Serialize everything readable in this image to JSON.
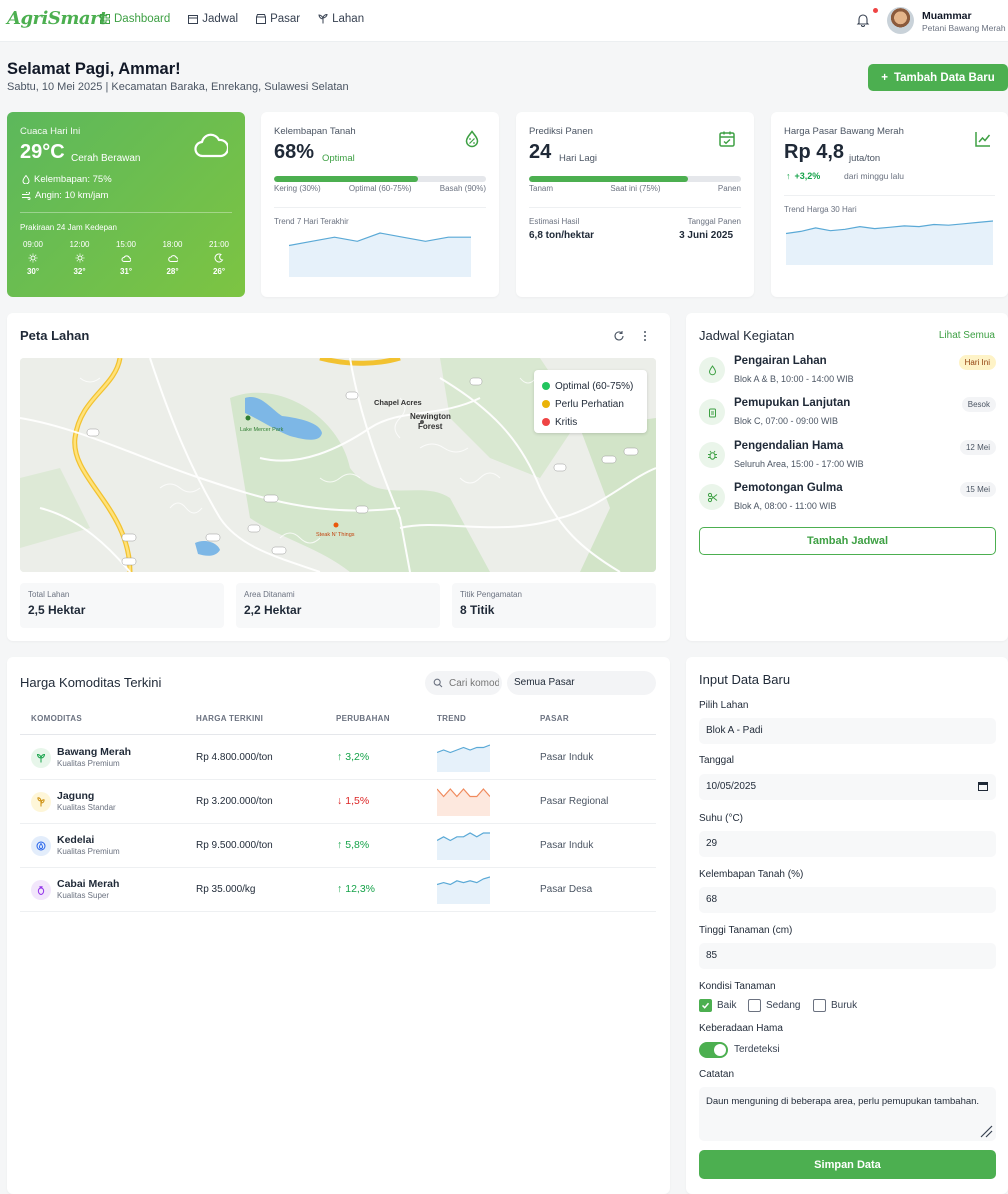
{
  "nav": {
    "logo": "AgriSmart",
    "links": [
      "Dashboard",
      "Jadwal",
      "Pasar",
      "Lahan"
    ],
    "user_name": "Muammar",
    "user_role": "Petani Bawang Merah"
  },
  "header": {
    "greeting": "Selamat Pagi, Ammar!",
    "subtitle": "Sabtu, 10 Mei 2025 | Kecamatan Baraka, Enrekang, Sulawesi Selatan",
    "add_button": "Tambah Data Baru"
  },
  "weather": {
    "label": "Cuaca Hari Ini",
    "temp": "29°C",
    "desc": "Cerah Berawan",
    "humidity": "Kelembapan: 75%",
    "wind": "Angin: 10 km/jam",
    "forecast_label": "Prakiraan 24 Jam Kedepan",
    "hours": [
      {
        "time": "09:00",
        "temp": "30°",
        "icon": "sun-icon"
      },
      {
        "time": "12:00",
        "temp": "32°",
        "icon": "sun-icon"
      },
      {
        "time": "15:00",
        "temp": "31°",
        "icon": "cloud-sun-icon"
      },
      {
        "time": "18:00",
        "temp": "28°",
        "icon": "cloud-icon"
      },
      {
        "time": "21:00",
        "temp": "26°",
        "icon": "moon-icon"
      }
    ]
  },
  "soil": {
    "title": "Kelembapan Tanah",
    "value": "68%",
    "status": "Optimal",
    "progress": 0.68,
    "labels": [
      "Kering (30%)",
      "Optimal (60-75%)",
      "Basah (90%)"
    ],
    "trend_label": "Trend 7 Hari Terakhir",
    "trend": [
      66,
      67,
      68,
      67,
      69,
      68,
      67,
      68,
      68
    ]
  },
  "harvest": {
    "title": "Prediksi Panen",
    "value": "24",
    "unit": "Hari Lagi",
    "progress": 0.75,
    "labels": [
      "Tanam",
      "Saat ini (75%)",
      "Panen"
    ],
    "est_label": "Estimasi Hasil",
    "est_value": "6,8 ton/hektar",
    "date_label": "Tanggal Panen",
    "date_value": "3 Juni 2025"
  },
  "market": {
    "title": "Harga Pasar Bawang Merah",
    "value": "Rp 4,8",
    "unit": "juta/ton",
    "change": "+3,2%",
    "change_note": "dari minggu lalu",
    "trend_label": "Trend Harga 30 Hari",
    "trend": [
      4.62,
      4.65,
      4.7,
      4.66,
      4.68,
      4.72,
      4.69,
      4.71,
      4.73,
      4.72,
      4.75,
      4.74,
      4.76,
      4.78,
      4.8
    ]
  },
  "map": {
    "title": "Peta Lahan",
    "legend": [
      {
        "label": "Optimal (60-75%)",
        "color": "#22c55e"
      },
      {
        "label": "Perlu Perhatian",
        "color": "#eab308"
      },
      {
        "label": "Kritis",
        "color": "#ef4444"
      }
    ],
    "places": [
      "Chapel Acres",
      "Newington",
      "Forest",
      "Lake Mercer Park",
      "Steak N' Things"
    ],
    "stats": [
      {
        "label": "Total Lahan",
        "value": "2,5 Hektar"
      },
      {
        "label": "Area Ditanami",
        "value": "2,2 Hektar"
      },
      {
        "label": "Titik Pengamatan",
        "value": "8 Titik"
      }
    ]
  },
  "schedule": {
    "title": "Jadwal Kegiatan",
    "see_all": "Lihat Semua",
    "items": [
      {
        "title": "Pengairan Lahan",
        "sub": "Blok A & B, 10:00 - 14:00 WIB",
        "badge": "Hari Ini"
      },
      {
        "title": "Pemupukan Lanjutan",
        "sub": "Blok C, 07:00 - 09:00 WIB",
        "badge": "Besok"
      },
      {
        "title": "Pengendalian Hama",
        "sub": "Seluruh Area, 15:00 - 17:00 WIB",
        "badge": "12 Mei"
      },
      {
        "title": "Pemotongan Gulma",
        "sub": "Blok A, 08:00 - 11:00 WIB",
        "badge": "15 Mei"
      }
    ],
    "add_button": "Tambah Jadwal"
  },
  "prices": {
    "title": "Harga Komoditas Terkini",
    "search_placeholder": "Cari komoditas",
    "market_select": "Semua Pasar",
    "columns": [
      "KOMODITAS",
      "HARGA TERKINI",
      "PERUBAHAN",
      "TREND",
      "PASAR"
    ],
    "rows": [
      {
        "name": "Bawang Merah",
        "quality": "Kualitas Premium",
        "price": "Rp 4.800.000/ton",
        "change": "3,2%",
        "dir": "up",
        "market": "Pasar Induk",
        "color": "#16a34a",
        "bg": "#e7f6ea",
        "trend": [
          5,
          6,
          5,
          6,
          7,
          6,
          7,
          7,
          8
        ]
      },
      {
        "name": "Jagung",
        "quality": "Kualitas Standar",
        "price": "Rp 3.200.000/ton",
        "change": "1,5%",
        "dir": "down",
        "market": "Pasar Regional",
        "color": "#ca8a04",
        "bg": "#fef6d8",
        "trend": [
          7,
          6,
          7,
          6,
          7,
          6,
          6,
          7,
          6
        ]
      },
      {
        "name": "Kedelai",
        "quality": "Kualitas Premium",
        "price": "Rp 9.500.000/ton",
        "change": "5,8%",
        "dir": "up",
        "market": "Pasar Induk",
        "color": "#2563eb",
        "bg": "#e3edfb",
        "trend": [
          5,
          6,
          5,
          6,
          6,
          7,
          6,
          7,
          7
        ]
      },
      {
        "name": "Cabai Merah",
        "quality": "Kualitas Super",
        "price": "Rp 35.000/kg",
        "change": "12,3%",
        "dir": "up",
        "market": "Pasar Desa",
        "color": "#9333ea",
        "bg": "#f2e6fb",
        "trend": [
          4,
          5,
          4,
          6,
          5,
          6,
          5,
          7,
          8
        ]
      }
    ]
  },
  "form": {
    "title": "Input Data Baru",
    "field_label": "Pilih Lahan",
    "field_value": "Blok A - Padi",
    "date_label": "Tanggal",
    "date_value": "10/05/2025",
    "temp_label": "Suhu (°C)",
    "temp_value": "29",
    "moist_label": "Kelembapan Tanah (%)",
    "moist_value": "68",
    "height_label": "Tinggi Tanaman (cm)",
    "height_value": "85",
    "cond_label": "Kondisi Tanaman",
    "conditions": [
      "Baik",
      "Sedang",
      "Buruk"
    ],
    "pest_label": "Keberadaan Hama",
    "pest_value": "Terdeteksi",
    "note_label": "Catatan",
    "note_value": "Daun menguning di beberapa area, perlu pemupukan tambahan.",
    "save_button": "Simpan Data"
  }
}
